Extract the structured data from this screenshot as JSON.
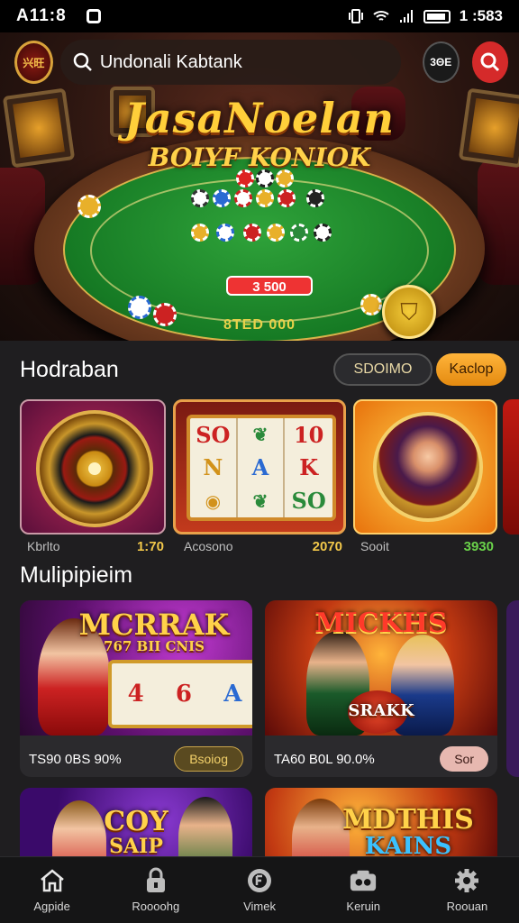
{
  "status_bar": {
    "time": "A11:8",
    "clock": "1 :583"
  },
  "header": {
    "logo_text": "兴旺",
    "search_value": "Undonali Kabtank",
    "badge_button_label": "3ΘE"
  },
  "hero": {
    "title": "JasaNoelan",
    "subtitle": "BOIYF KONIOK",
    "bet_label": "3 500",
    "pot_label": "8TED 000"
  },
  "section_popular": {
    "title": "Hodraban",
    "filters": [
      {
        "label": "SDOIMO"
      },
      {
        "label": "Kaclop"
      }
    ],
    "cards": [
      {
        "name": "Kbrlto",
        "value": "1:70"
      },
      {
        "name": "Acosono",
        "value": "2070"
      },
      {
        "name": "Sooit",
        "value": "3930"
      }
    ],
    "slot_symbols": [
      "SO",
      "10",
      "N",
      "A",
      "K",
      "SO"
    ]
  },
  "section_multiplayer": {
    "title": "Mulipipieim",
    "cards": [
      {
        "title": "MCRRAK",
        "subtitle": "767 BII CNIS",
        "odds": "TS90 0BS 90%",
        "button": "Bsoiog"
      },
      {
        "title": "MICKHS",
        "subtitle": "SRAKK",
        "odds": "TA60 B0L 90.0%",
        "button": "Sor"
      },
      {
        "title": "COY",
        "subtitle": "SAIP"
      },
      {
        "title": "MDTHIS",
        "subtitle": "KAINS"
      }
    ]
  },
  "bottom_nav": {
    "items": [
      {
        "label": "Agpide",
        "icon": "home-icon"
      },
      {
        "label": "Roooohg",
        "icon": "lock-icon"
      },
      {
        "label": "Vimek",
        "icon": "poker-chip-icon"
      },
      {
        "label": "Keruin",
        "icon": "wallet-icon"
      },
      {
        "label": "Roouan",
        "icon": "gear-icon"
      }
    ]
  },
  "colors": {
    "accent": "#e8901a",
    "brand_red": "#d52a2a",
    "background": "#1f1e20"
  }
}
